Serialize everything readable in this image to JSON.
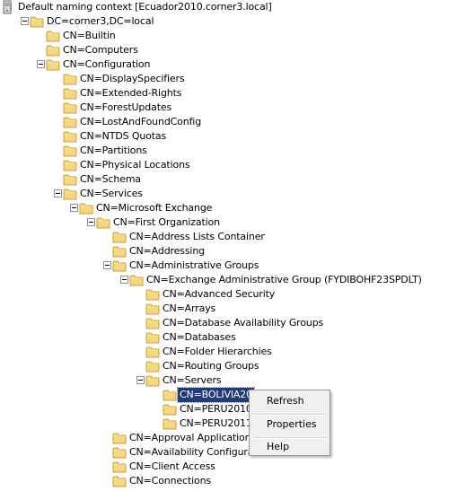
{
  "tree": [
    {
      "label": "Default naming context [Ecuador2010.corner3.local]",
      "level": 0,
      "expander": true,
      "icon": "server-icon"
    },
    {
      "label": "DC=corner3,DC=local",
      "level": 1,
      "expander": true,
      "icon": "folder-icon"
    },
    {
      "label": "CN=Builtin",
      "level": 2,
      "expander": false,
      "icon": "folder-icon"
    },
    {
      "label": "CN=Computers",
      "level": 2,
      "expander": false,
      "icon": "folder-icon"
    },
    {
      "label": "CN=Configuration",
      "level": 2,
      "expander": true,
      "icon": "folder-icon"
    },
    {
      "label": "CN=DisplaySpecifiers",
      "level": 3,
      "expander": false,
      "icon": "folder-icon"
    },
    {
      "label": "CN=Extended-Rights",
      "level": 3,
      "expander": false,
      "icon": "folder-icon"
    },
    {
      "label": "CN=ForestUpdates",
      "level": 3,
      "expander": false,
      "icon": "folder-icon"
    },
    {
      "label": "CN=LostAndFoundConfig",
      "level": 3,
      "expander": false,
      "icon": "folder-icon"
    },
    {
      "label": "CN=NTDS Quotas",
      "level": 3,
      "expander": false,
      "icon": "folder-icon"
    },
    {
      "label": "CN=Partitions",
      "level": 3,
      "expander": false,
      "icon": "folder-icon"
    },
    {
      "label": "CN=Physical Locations",
      "level": 3,
      "expander": false,
      "icon": "folder-icon"
    },
    {
      "label": "CN=Schema",
      "level": 3,
      "expander": false,
      "icon": "folder-icon"
    },
    {
      "label": "CN=Services",
      "level": 3,
      "expander": true,
      "icon": "folder-icon"
    },
    {
      "label": "CN=Microsoft Exchange",
      "level": 4,
      "expander": true,
      "icon": "folder-icon"
    },
    {
      "label": "CN=First Organization",
      "level": 5,
      "expander": true,
      "icon": "folder-icon"
    },
    {
      "label": "CN=Address Lists Container",
      "level": 6,
      "expander": false,
      "icon": "folder-icon"
    },
    {
      "label": "CN=Addressing",
      "level": 6,
      "expander": false,
      "icon": "folder-icon"
    },
    {
      "label": "CN=Administrative Groups",
      "level": 6,
      "expander": true,
      "icon": "folder-icon"
    },
    {
      "label": "CN=Exchange Administrative Group (FYDIBOHF23SPDLT)",
      "level": 7,
      "expander": true,
      "icon": "folder-icon"
    },
    {
      "label": "CN=Advanced Security",
      "level": 8,
      "expander": false,
      "icon": "folder-icon"
    },
    {
      "label": "CN=Arrays",
      "level": 8,
      "expander": false,
      "icon": "folder-icon"
    },
    {
      "label": "CN=Database Availability Groups",
      "level": 8,
      "expander": false,
      "icon": "folder-icon"
    },
    {
      "label": "CN=Databases",
      "level": 8,
      "expander": false,
      "icon": "folder-icon"
    },
    {
      "label": "CN=Folder Hierarchies",
      "level": 8,
      "expander": false,
      "icon": "folder-icon"
    },
    {
      "label": "CN=Routing Groups",
      "level": 8,
      "expander": false,
      "icon": "folder-icon"
    },
    {
      "label": "CN=Servers",
      "level": 8,
      "expander": true,
      "icon": "folder-icon"
    },
    {
      "label": "CN=BOLIVIA20",
      "level": 9,
      "expander": false,
      "icon": "folder-icon",
      "selected": true
    },
    {
      "label": "CN=PERU2010",
      "level": 9,
      "expander": false,
      "icon": "folder-icon"
    },
    {
      "label": "CN=PERU2011",
      "level": 9,
      "expander": false,
      "icon": "folder-icon"
    },
    {
      "label": "CN=Approval Applications",
      "level": 6,
      "expander": false,
      "icon": "folder-icon"
    },
    {
      "label": "CN=Availability Configuratio",
      "level": 6,
      "expander": false,
      "icon": "folder-icon"
    },
    {
      "label": "CN=Client Access",
      "level": 6,
      "expander": false,
      "icon": "folder-icon"
    },
    {
      "label": "CN=Connections",
      "level": 6,
      "expander": false,
      "icon": "folder-icon"
    }
  ],
  "context_menu": {
    "items": [
      "Refresh",
      "Properties",
      "Help"
    ]
  },
  "colors": {
    "selection": "#1f3b7a",
    "folder": "#f4d77a"
  }
}
